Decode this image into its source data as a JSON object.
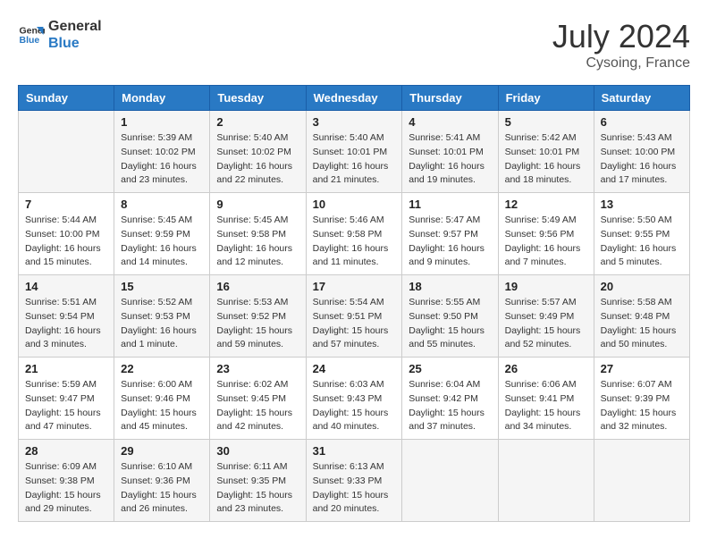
{
  "header": {
    "logo_line1": "General",
    "logo_line2": "Blue",
    "month_year": "July 2024",
    "location": "Cysoing, France"
  },
  "weekdays": [
    "Sunday",
    "Monday",
    "Tuesday",
    "Wednesday",
    "Thursday",
    "Friday",
    "Saturday"
  ],
  "weeks": [
    [
      {
        "day": "",
        "info": ""
      },
      {
        "day": "1",
        "info": "Sunrise: 5:39 AM\nSunset: 10:02 PM\nDaylight: 16 hours\nand 23 minutes."
      },
      {
        "day": "2",
        "info": "Sunrise: 5:40 AM\nSunset: 10:02 PM\nDaylight: 16 hours\nand 22 minutes."
      },
      {
        "day": "3",
        "info": "Sunrise: 5:40 AM\nSunset: 10:01 PM\nDaylight: 16 hours\nand 21 minutes."
      },
      {
        "day": "4",
        "info": "Sunrise: 5:41 AM\nSunset: 10:01 PM\nDaylight: 16 hours\nand 19 minutes."
      },
      {
        "day": "5",
        "info": "Sunrise: 5:42 AM\nSunset: 10:01 PM\nDaylight: 16 hours\nand 18 minutes."
      },
      {
        "day": "6",
        "info": "Sunrise: 5:43 AM\nSunset: 10:00 PM\nDaylight: 16 hours\nand 17 minutes."
      }
    ],
    [
      {
        "day": "7",
        "info": "Sunrise: 5:44 AM\nSunset: 10:00 PM\nDaylight: 16 hours\nand 15 minutes."
      },
      {
        "day": "8",
        "info": "Sunrise: 5:45 AM\nSunset: 9:59 PM\nDaylight: 16 hours\nand 14 minutes."
      },
      {
        "day": "9",
        "info": "Sunrise: 5:45 AM\nSunset: 9:58 PM\nDaylight: 16 hours\nand 12 minutes."
      },
      {
        "day": "10",
        "info": "Sunrise: 5:46 AM\nSunset: 9:58 PM\nDaylight: 16 hours\nand 11 minutes."
      },
      {
        "day": "11",
        "info": "Sunrise: 5:47 AM\nSunset: 9:57 PM\nDaylight: 16 hours\nand 9 minutes."
      },
      {
        "day": "12",
        "info": "Sunrise: 5:49 AM\nSunset: 9:56 PM\nDaylight: 16 hours\nand 7 minutes."
      },
      {
        "day": "13",
        "info": "Sunrise: 5:50 AM\nSunset: 9:55 PM\nDaylight: 16 hours\nand 5 minutes."
      }
    ],
    [
      {
        "day": "14",
        "info": "Sunrise: 5:51 AM\nSunset: 9:54 PM\nDaylight: 16 hours\nand 3 minutes."
      },
      {
        "day": "15",
        "info": "Sunrise: 5:52 AM\nSunset: 9:53 PM\nDaylight: 16 hours\nand 1 minute."
      },
      {
        "day": "16",
        "info": "Sunrise: 5:53 AM\nSunset: 9:52 PM\nDaylight: 15 hours\nand 59 minutes."
      },
      {
        "day": "17",
        "info": "Sunrise: 5:54 AM\nSunset: 9:51 PM\nDaylight: 15 hours\nand 57 minutes."
      },
      {
        "day": "18",
        "info": "Sunrise: 5:55 AM\nSunset: 9:50 PM\nDaylight: 15 hours\nand 55 minutes."
      },
      {
        "day": "19",
        "info": "Sunrise: 5:57 AM\nSunset: 9:49 PM\nDaylight: 15 hours\nand 52 minutes."
      },
      {
        "day": "20",
        "info": "Sunrise: 5:58 AM\nSunset: 9:48 PM\nDaylight: 15 hours\nand 50 minutes."
      }
    ],
    [
      {
        "day": "21",
        "info": "Sunrise: 5:59 AM\nSunset: 9:47 PM\nDaylight: 15 hours\nand 47 minutes."
      },
      {
        "day": "22",
        "info": "Sunrise: 6:00 AM\nSunset: 9:46 PM\nDaylight: 15 hours\nand 45 minutes."
      },
      {
        "day": "23",
        "info": "Sunrise: 6:02 AM\nSunset: 9:45 PM\nDaylight: 15 hours\nand 42 minutes."
      },
      {
        "day": "24",
        "info": "Sunrise: 6:03 AM\nSunset: 9:43 PM\nDaylight: 15 hours\nand 40 minutes."
      },
      {
        "day": "25",
        "info": "Sunrise: 6:04 AM\nSunset: 9:42 PM\nDaylight: 15 hours\nand 37 minutes."
      },
      {
        "day": "26",
        "info": "Sunrise: 6:06 AM\nSunset: 9:41 PM\nDaylight: 15 hours\nand 34 minutes."
      },
      {
        "day": "27",
        "info": "Sunrise: 6:07 AM\nSunset: 9:39 PM\nDaylight: 15 hours\nand 32 minutes."
      }
    ],
    [
      {
        "day": "28",
        "info": "Sunrise: 6:09 AM\nSunset: 9:38 PM\nDaylight: 15 hours\nand 29 minutes."
      },
      {
        "day": "29",
        "info": "Sunrise: 6:10 AM\nSunset: 9:36 PM\nDaylight: 15 hours\nand 26 minutes."
      },
      {
        "day": "30",
        "info": "Sunrise: 6:11 AM\nSunset: 9:35 PM\nDaylight: 15 hours\nand 23 minutes."
      },
      {
        "day": "31",
        "info": "Sunrise: 6:13 AM\nSunset: 9:33 PM\nDaylight: 15 hours\nand 20 minutes."
      },
      {
        "day": "",
        "info": ""
      },
      {
        "day": "",
        "info": ""
      },
      {
        "day": "",
        "info": ""
      }
    ]
  ]
}
